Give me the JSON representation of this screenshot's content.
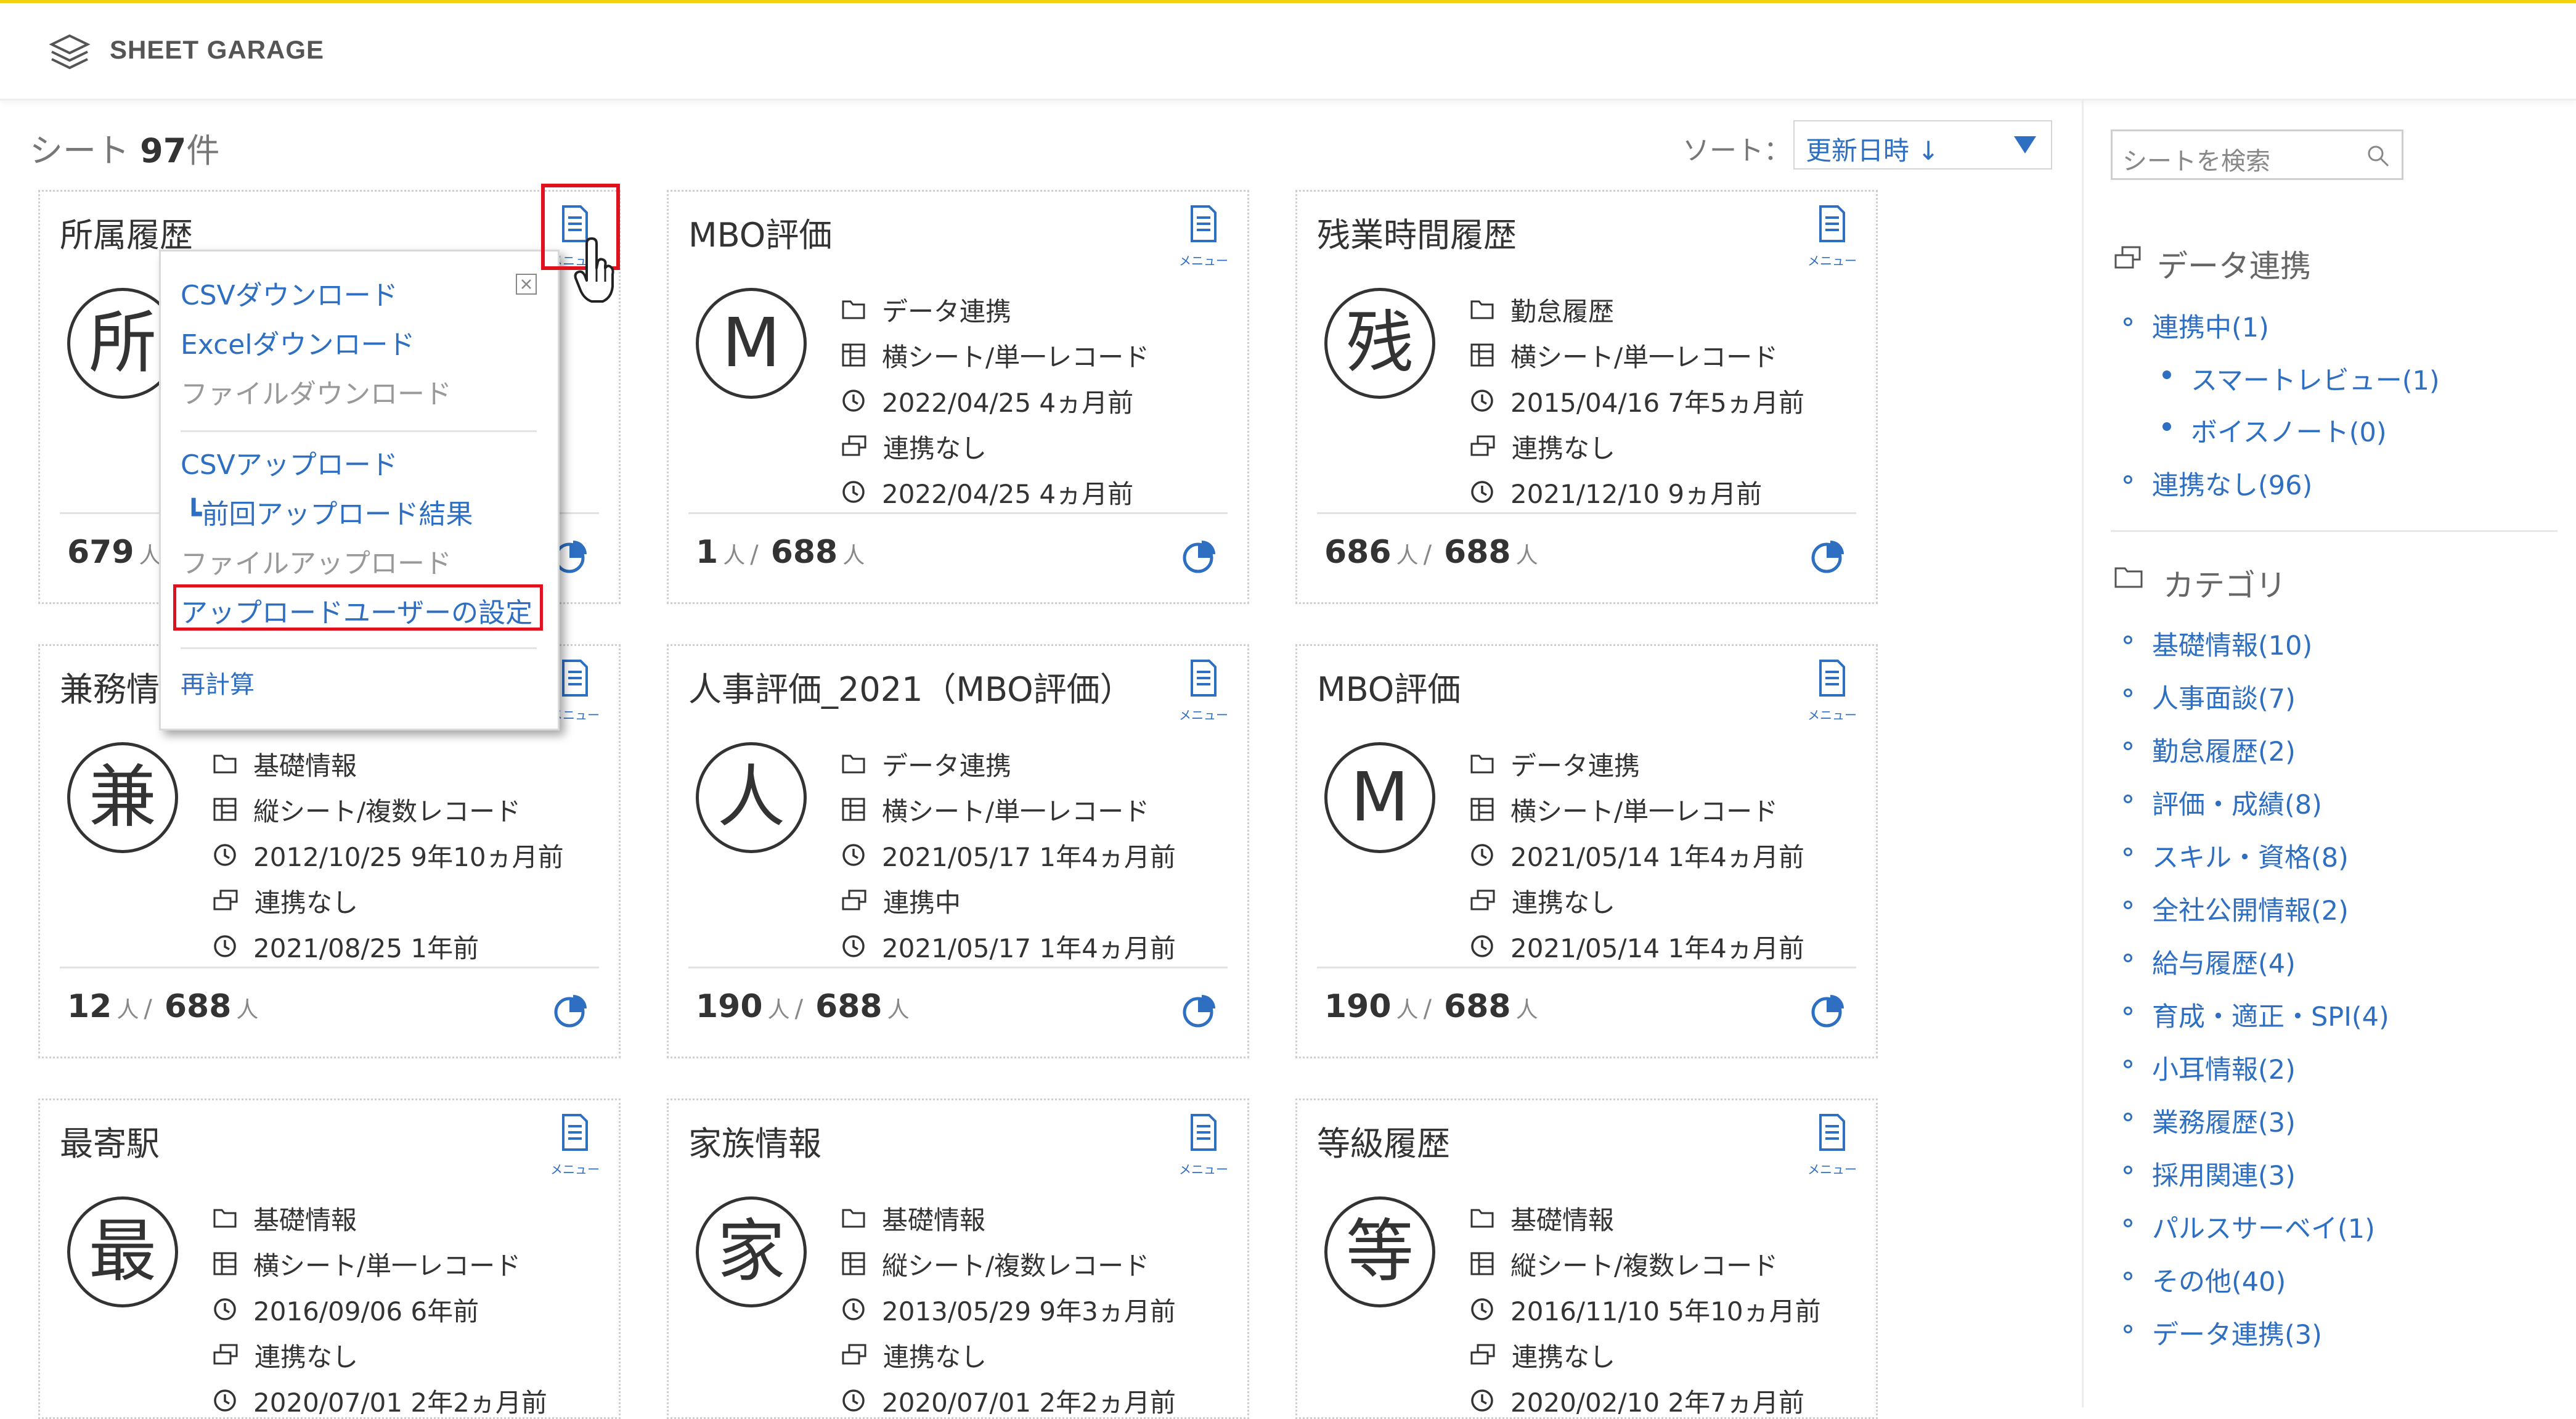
{
  "app": {
    "name": "SHEET GARAGE"
  },
  "summary": {
    "prefix": "シート ",
    "count": "97",
    "suffix": "件"
  },
  "sort": {
    "label": "ソート：",
    "value": "更新日時 ↓"
  },
  "menu_icon_label": "メニュー",
  "cards": [
    {
      "title": "所属履歴",
      "avatar": "所",
      "category": "",
      "layout": "",
      "updated": "",
      "link": "",
      "data_date": "",
      "count": "679",
      "total": "",
      "unit": "人"
    },
    {
      "title": "MBO評価",
      "avatar": "M",
      "category": "データ連携",
      "layout": "横シート/単一レコード",
      "updated": "2022/04/25 4ヵ月前",
      "link": "連携なし",
      "data_date": "2022/04/25 4ヵ月前",
      "count": "1",
      "total": "688",
      "unit": "人"
    },
    {
      "title": "残業時間履歴",
      "avatar": "残",
      "category": "勤怠履歴",
      "layout": "横シート/単一レコード",
      "updated": "2015/04/16 7年5ヵ月前",
      "link": "連携なし",
      "data_date": "2021/12/10 9ヵ月前",
      "count": "686",
      "total": "688",
      "unit": "人"
    },
    {
      "title": "兼務情",
      "avatar": "兼",
      "category": "基礎情報",
      "layout": "縦シート/複数レコード",
      "updated": "2012/10/25 9年10ヵ月前",
      "link": "連携なし",
      "data_date": "2021/08/25 1年前",
      "count": "12",
      "total": "688",
      "unit": "人"
    },
    {
      "title": "人事評価_2021（MBO評価）",
      "avatar": "人",
      "category": "データ連携",
      "layout": "横シート/単一レコード",
      "updated": "2021/05/17 1年4ヵ月前",
      "link": "連携中",
      "data_date": "2021/05/17 1年4ヵ月前",
      "count": "190",
      "total": "688",
      "unit": "人"
    },
    {
      "title": "MBO評価",
      "avatar": "M",
      "category": "データ連携",
      "layout": "横シート/単一レコード",
      "updated": "2021/05/14 1年4ヵ月前",
      "link": "連携なし",
      "data_date": "2021/05/14 1年4ヵ月前",
      "count": "190",
      "total": "688",
      "unit": "人"
    },
    {
      "title": "最寄駅",
      "avatar": "最",
      "category": "基礎情報",
      "layout": "横シート/単一レコード",
      "updated": "2016/09/06 6年前",
      "link": "連携なし",
      "data_date": "2020/07/01 2年2ヵ月前",
      "count": "",
      "total": "",
      "unit": ""
    },
    {
      "title": "家族情報",
      "avatar": "家",
      "category": "基礎情報",
      "layout": "縦シート/複数レコード",
      "updated": "2013/05/29 9年3ヵ月前",
      "link": "連携なし",
      "data_date": "2020/07/01 2年2ヵ月前",
      "count": "",
      "total": "",
      "unit": ""
    },
    {
      "title": "等級履歴",
      "avatar": "等",
      "category": "基礎情報",
      "layout": "縦シート/複数レコード",
      "updated": "2016/11/10 5年10ヵ月前",
      "link": "連携なし",
      "data_date": "2020/02/10 2年7ヵ月前",
      "count": "",
      "total": "",
      "unit": ""
    }
  ],
  "popup": {
    "items": {
      "csv_download": "CSVダウンロード",
      "excel_download": "Excelダウンロード",
      "file_download": "ファイルダウンロード",
      "csv_upload": "CSVアップロード",
      "last_upload": "┗前回アップロード結果",
      "file_upload": "ファイルアップロード",
      "upload_user": "アップロードユーザーの設定",
      "recalc": "再計算"
    }
  },
  "sidebar": {
    "search_placeholder": "シートを検索",
    "data_link": {
      "title": "データ連携",
      "items": [
        "連携中(1)",
        "スマートレビュー(1)",
        "ボイスノート(0)",
        "連携なし(96)"
      ]
    },
    "category": {
      "title": "カテゴリ",
      "items": [
        "基礎情報(10)",
        "人事面談(7)",
        "勤怠履歴(2)",
        "評価・成績(8)",
        "スキル・資格(8)",
        "全社公開情報(2)",
        "給与履歴(4)",
        "育成・適正・SPI(4)",
        "小耳情報(2)",
        "業務履歴(3)",
        "採用関連(3)",
        "パルスサーベイ(1)",
        "その他(40)",
        "データ連携(3)"
      ]
    }
  },
  "colors": {
    "accent": "#2e6fc1",
    "highlight": "#e0121e",
    "topbar": "#f5d20f"
  }
}
